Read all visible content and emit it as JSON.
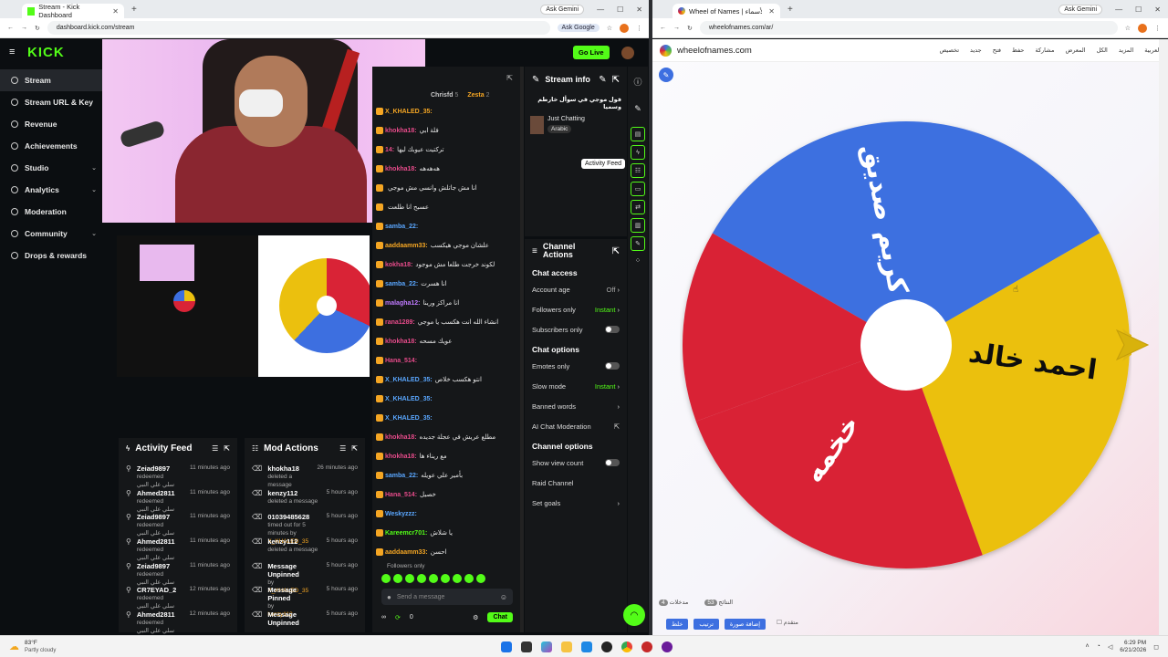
{
  "left_browser": {
    "tab_title": "Stream - Kick Dashboard",
    "url": "dashboard.kick.com/stream",
    "ask_google": "Ask Google",
    "ask_gemini": "Ask Gemini"
  },
  "kick": {
    "logo": "KICK",
    "go_live": "Go Live",
    "sidebar": [
      {
        "label": "Stream",
        "active": true,
        "chevron": false
      },
      {
        "label": "Stream URL & Key",
        "active": false,
        "chevron": false
      },
      {
        "label": "Revenue",
        "active": false,
        "chevron": false
      },
      {
        "label": "Achievements",
        "active": false,
        "chevron": false
      },
      {
        "label": "Studio",
        "active": false,
        "chevron": true
      },
      {
        "label": "Analytics",
        "active": false,
        "chevron": true
      },
      {
        "label": "Moderation",
        "active": false,
        "chevron": false
      },
      {
        "label": "Community",
        "active": false,
        "chevron": true
      },
      {
        "label": "Drops & rewards",
        "active": false,
        "chevron": false
      }
    ],
    "activity_feed": {
      "title": "Activity Feed",
      "items": [
        {
          "name": "Zeiad9897",
          "sub": "redeemed",
          "reward": "سلي علي النبي",
          "time": "11 minutes ago"
        },
        {
          "name": "Ahmed2811",
          "sub": "redeemed",
          "reward": "سلي علي النبي",
          "time": "11 minutes ago"
        },
        {
          "name": "Zeiad9897",
          "sub": "redeemed",
          "reward": "سلي علي النبي",
          "time": "11 minutes ago"
        },
        {
          "name": "Ahmed2811",
          "sub": "redeemed",
          "reward": "سلي علي النبي",
          "time": "11 minutes ago"
        },
        {
          "name": "Zeiad9897",
          "sub": "redeemed",
          "reward": "سلي علي النبي",
          "time": "11 minutes ago"
        },
        {
          "name": "CR7EYAD_2",
          "sub": "redeemed",
          "reward": "سلي علي النبي",
          "time": "12 minutes ago"
        },
        {
          "name": "Ahmed2811",
          "sub": "redeemed",
          "reward": "سلي علي النبي",
          "time": "12 minutes ago"
        }
      ]
    },
    "mod_actions": {
      "title": "Mod Actions",
      "items": [
        {
          "name": "khokha18",
          "sub": "deleted a message",
          "time": "26 minutes ago",
          "by": ""
        },
        {
          "name": "kenzy112",
          "sub": "deleted a message",
          "time": "5 hours ago",
          "by": ""
        },
        {
          "name": "01039485628",
          "sub": "timed out for 5 minutes by",
          "time": "5 hours ago",
          "by": "X_KHALED_35"
        },
        {
          "name": "kenzy112",
          "sub": "deleted a message",
          "time": "5 hours ago",
          "by": ""
        },
        {
          "name": "Message Unpinned",
          "sub": "by",
          "time": "5 hours ago",
          "by": "X_KHALED_35"
        },
        {
          "name": "Message Pinned",
          "sub": "by",
          "time": "5 hours ago",
          "by": "kenzy112"
        },
        {
          "name": "Message Unpinned",
          "sub": "",
          "time": "5 hours ago",
          "by": ""
        }
      ]
    },
    "chat": {
      "top_users": [
        {
          "name": "Chrisfd",
          "count": "5"
        },
        {
          "name": "Zesta",
          "count": "2"
        }
      ],
      "lines": [
        {
          "user": "X_KHALED_35:",
          "color": "#f5a623",
          "text": ""
        },
        {
          "user": "khokha18:",
          "color": "#e64b8a",
          "text": "فلة ابي"
        },
        {
          "user": "14:",
          "color": "#e64b8a",
          "text": "تركتيت عيوبك ليها"
        },
        {
          "user": "khokha18:",
          "color": "#e64b8a",
          "text": "ﻫﻪﻫﻪﻫﻪ"
        },
        {
          "user": "",
          "color": "#ccc",
          "text": "انا مش جاتلش وانسي مش موجي"
        },
        {
          "user": "",
          "color": "#ccc",
          "text": "عسبح انا طلعت"
        },
        {
          "user": "samba_22:",
          "color": "#5aa7ff",
          "text": ""
        },
        {
          "user": "aaddaamm33:",
          "color": "#f5a623",
          "text": "علشان موجي هيكسب"
        },
        {
          "user": "kokha18:",
          "color": "#e64b8a",
          "text": "لكوند خرجت طلعا مش موجود"
        },
        {
          "user": "samba_22:",
          "color": "#5aa7ff",
          "text": "انا هسرت"
        },
        {
          "user": "malagha12:",
          "color": "#c07aff",
          "text": "انا مراكز ورينا"
        },
        {
          "user": "rana1289:",
          "color": "#e64b8a",
          "text": "انشاء الله انت هكسب يا موجي"
        },
        {
          "user": "khokha18:",
          "color": "#e64b8a",
          "text": "عويك مسحه"
        },
        {
          "user": "Hana_514:",
          "color": "#e64b8a",
          "text": ""
        },
        {
          "user": "X_KHALED_35:",
          "color": "#5aa7ff",
          "text": "انتو هكسب خلاص"
        },
        {
          "user": "X_KHALED_35:",
          "color": "#5aa7ff",
          "text": ""
        },
        {
          "user": "X_KHALED_35:",
          "color": "#5aa7ff",
          "text": ""
        },
        {
          "user": "khokha18:",
          "color": "#e64b8a",
          "text": "مطلع عريش في عجلة جديده"
        },
        {
          "user": "khokha18:",
          "color": "#e64b8a",
          "text": "مع ريناء ها"
        },
        {
          "user": "samba_22:",
          "color": "#5aa7ff",
          "text": "بأمير علي عويله"
        },
        {
          "user": "Hana_514:",
          "color": "#e64b8a",
          "text": "خصيل"
        },
        {
          "user": "Weskyzzz:",
          "color": "#5aa7ff",
          "text": ""
        },
        {
          "user": "Kareemcr701:",
          "color": "#53fc18",
          "text": "يا شلاش"
        },
        {
          "user": "aaddaamm33:",
          "color": "#f5a623",
          "text": "احسن"
        }
      ],
      "followers_only": "Followers only",
      "send_placeholder": "Send a message",
      "count": "0",
      "chat_button": "Chat"
    },
    "stream_info": {
      "title": "Stream info",
      "stream_title": "فول موجي في سوأل خارطم وسميا",
      "category": "Just Chatting",
      "language": "Arabic"
    },
    "channel_actions": {
      "title": "Channel Actions",
      "chat_access": "Chat access",
      "account_age": "Account age",
      "account_age_val": "Off",
      "followers_only": "Followers only",
      "followers_only_val": "Instant",
      "subscribers_only": "Subscribers only",
      "chat_options": "Chat options",
      "emotes_only": "Emotes only",
      "slow_mode": "Slow mode",
      "slow_mode_val": "Instant",
      "banned_words": "Banned words",
      "ai_chat": "AI Chat Moderation",
      "channel_options": "Channel options",
      "show_view_count": "Show view count",
      "raid_channel": "Raid Channel",
      "set_goals": "Set goals"
    },
    "tooltip": "Activity Feed"
  },
  "right_browser": {
    "tab_title": "Wheel of Names | عجلة الأسماء",
    "url": "wheelofnames.com/ar/",
    "ask_gemini": "Ask Gemini",
    "site_name": "wheelofnames.com",
    "menu": [
      "تخصيص",
      "جديد",
      "فتح",
      "حفظ",
      "مشاركة",
      "المعرض",
      "الكل",
      "المزيد",
      "العربية"
    ],
    "bottom_tabs": [
      {
        "label": "مدخلات",
        "count": "4"
      },
      {
        "label": "النتائج",
        "count": "53"
      }
    ],
    "bottom_buttons": [
      "خلط",
      "ترتيب",
      "إضافة صورة"
    ],
    "bottom_check": "متقدم"
  },
  "wheel": {
    "segments": [
      {
        "label": "كريم صديق",
        "color": "#3d6fe0"
      },
      {
        "label": "احمد خالد",
        "color": "#ebc00e"
      },
      {
        "label": "خخمه",
        "color": "#d92336"
      },
      {
        "label": "",
        "color": "#d92336"
      }
    ]
  },
  "taskbar": {
    "weather_temp": "83°F",
    "weather_desc": "Partly cloudy",
    "time": "6:29 PM",
    "date": "6/21/2026"
  }
}
